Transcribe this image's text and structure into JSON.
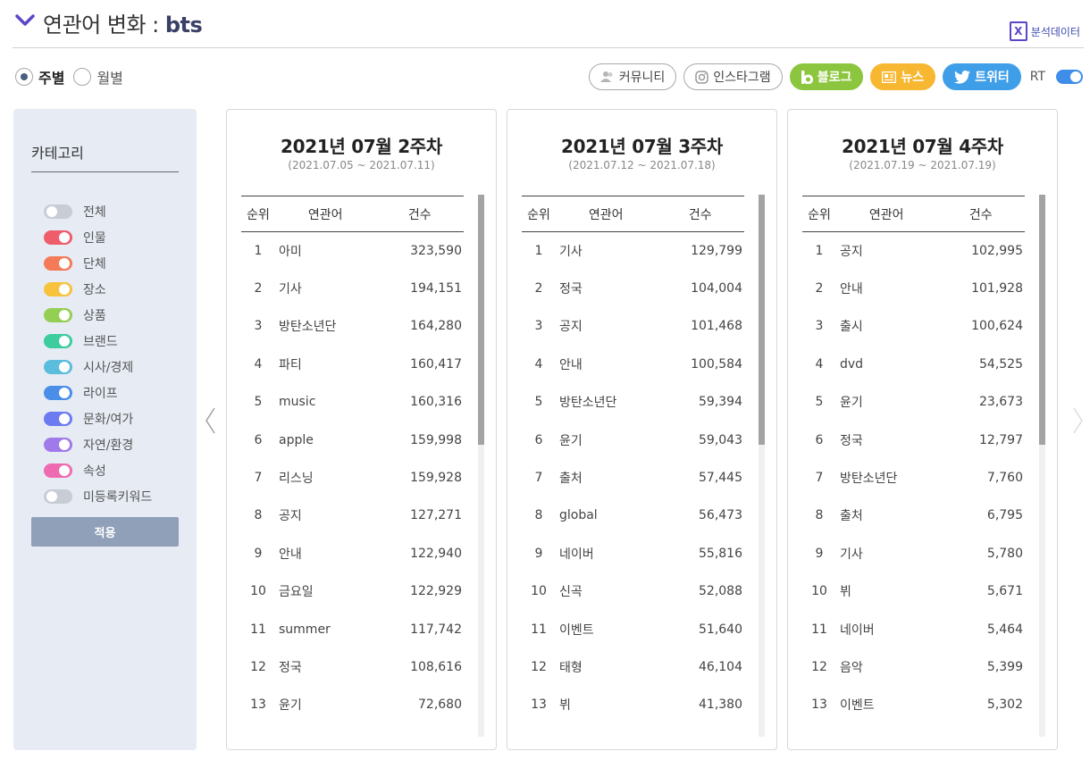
{
  "header": {
    "title_prefix": "연관어 변화 : ",
    "keyword": "bts",
    "excel_label": "분석데이터"
  },
  "period": {
    "options": [
      {
        "label": "주별",
        "selected": true
      },
      {
        "label": "월별",
        "selected": false
      }
    ]
  },
  "sources": {
    "community": "커뮤니티",
    "instagram": "인스타그램",
    "blog": "블로그",
    "news": "뉴스",
    "twitter": "트위터",
    "rt": "RT"
  },
  "sidebar": {
    "title": "카테고리",
    "apply_label": "적용",
    "categories": [
      {
        "label": "전체",
        "color": "#c8ccd4",
        "on": false
      },
      {
        "label": "인물",
        "color": "#ef5c6c",
        "on": true
      },
      {
        "label": "단체",
        "color": "#f57a58",
        "on": true
      },
      {
        "label": "장소",
        "color": "#f7c33d",
        "on": true
      },
      {
        "label": "상품",
        "color": "#93cf52",
        "on": true
      },
      {
        "label": "브랜드",
        "color": "#3ccc9d",
        "on": true
      },
      {
        "label": "시사/경제",
        "color": "#5bbcdc",
        "on": true
      },
      {
        "label": "라이프",
        "color": "#4b8ee8",
        "on": true
      },
      {
        "label": "문화/여가",
        "color": "#6c7bf0",
        "on": true
      },
      {
        "label": "자연/환경",
        "color": "#a07ae8",
        "on": true
      },
      {
        "label": "속성",
        "color": "#ee6bb2",
        "on": true
      },
      {
        "label": "미등록키워드",
        "color": "#c8ccd4",
        "on": false
      }
    ]
  },
  "table_headers": {
    "rank": "순위",
    "keyword": "연관어",
    "count": "건수"
  },
  "weeks": [
    {
      "title": "2021년 07월 2주차",
      "range": "(2021.07.05 ~ 2021.07.11)",
      "rows": [
        {
          "rank": "1",
          "keyword": "아미",
          "count": "323,590"
        },
        {
          "rank": "2",
          "keyword": "기사",
          "count": "194,151"
        },
        {
          "rank": "3",
          "keyword": "방탄소년단",
          "count": "164,280"
        },
        {
          "rank": "4",
          "keyword": "파티",
          "count": "160,417"
        },
        {
          "rank": "5",
          "keyword": "music",
          "count": "160,316"
        },
        {
          "rank": "6",
          "keyword": "apple",
          "count": "159,998"
        },
        {
          "rank": "7",
          "keyword": "리스닝",
          "count": "159,928"
        },
        {
          "rank": "8",
          "keyword": "공지",
          "count": "127,271"
        },
        {
          "rank": "9",
          "keyword": "안내",
          "count": "122,940"
        },
        {
          "rank": "10",
          "keyword": "금요일",
          "count": "122,929"
        },
        {
          "rank": "11",
          "keyword": "summer",
          "count": "117,742"
        },
        {
          "rank": "12",
          "keyword": "정국",
          "count": "108,616"
        },
        {
          "rank": "13",
          "keyword": "윤기",
          "count": "72,680"
        }
      ]
    },
    {
      "title": "2021년 07월 3주차",
      "range": "(2021.07.12 ~ 2021.07.18)",
      "rows": [
        {
          "rank": "1",
          "keyword": "기사",
          "count": "129,799"
        },
        {
          "rank": "2",
          "keyword": "정국",
          "count": "104,004"
        },
        {
          "rank": "3",
          "keyword": "공지",
          "count": "101,468"
        },
        {
          "rank": "4",
          "keyword": "안내",
          "count": "100,584"
        },
        {
          "rank": "5",
          "keyword": "방탄소년단",
          "count": "59,394"
        },
        {
          "rank": "6",
          "keyword": "윤기",
          "count": "59,043"
        },
        {
          "rank": "7",
          "keyword": "출처",
          "count": "57,445"
        },
        {
          "rank": "8",
          "keyword": "global",
          "count": "56,473"
        },
        {
          "rank": "9",
          "keyword": "네이버",
          "count": "55,816"
        },
        {
          "rank": "10",
          "keyword": "신곡",
          "count": "52,088"
        },
        {
          "rank": "11",
          "keyword": "이벤트",
          "count": "51,640"
        },
        {
          "rank": "12",
          "keyword": "태형",
          "count": "46,104"
        },
        {
          "rank": "13",
          "keyword": "뷔",
          "count": "41,380"
        }
      ]
    },
    {
      "title": "2021년 07월 4주차",
      "range": "(2021.07.19 ~ 2021.07.19)",
      "rows": [
        {
          "rank": "1",
          "keyword": "공지",
          "count": "102,995"
        },
        {
          "rank": "2",
          "keyword": "안내",
          "count": "101,928"
        },
        {
          "rank": "3",
          "keyword": "출시",
          "count": "100,624"
        },
        {
          "rank": "4",
          "keyword": "dvd",
          "count": "54,525"
        },
        {
          "rank": "5",
          "keyword": "윤기",
          "count": "23,673"
        },
        {
          "rank": "6",
          "keyword": "정국",
          "count": "12,797"
        },
        {
          "rank": "7",
          "keyword": "방탄소년단",
          "count": "7,760"
        },
        {
          "rank": "8",
          "keyword": "출처",
          "count": "6,795"
        },
        {
          "rank": "9",
          "keyword": "기사",
          "count": "5,780"
        },
        {
          "rank": "10",
          "keyword": "뷔",
          "count": "5,671"
        },
        {
          "rank": "11",
          "keyword": "네이버",
          "count": "5,464"
        },
        {
          "rank": "12",
          "keyword": "음악",
          "count": "5,399"
        },
        {
          "rank": "13",
          "keyword": "이벤트",
          "count": "5,302"
        }
      ]
    }
  ]
}
